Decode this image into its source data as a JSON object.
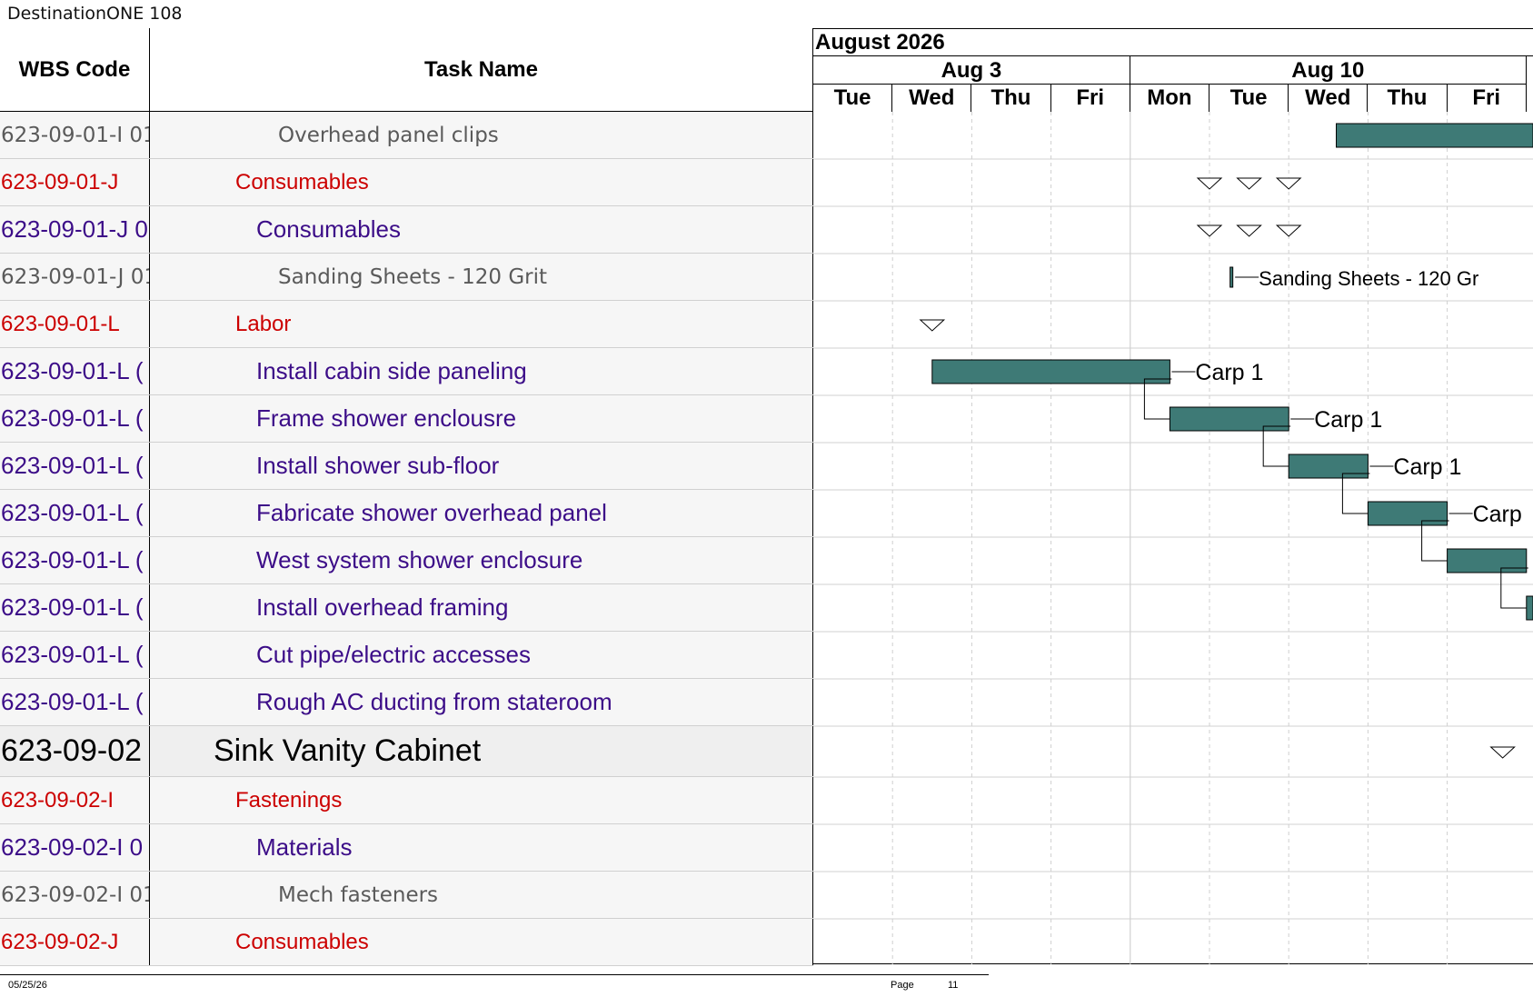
{
  "document": {
    "title": "DestinationONE 108"
  },
  "columns": {
    "wbs": "WBS Code",
    "task": "Task Name"
  },
  "timeline": {
    "month": "August 2026",
    "weeks": [
      {
        "label": "Aug 3"
      },
      {
        "label": "Aug 10"
      }
    ],
    "days": [
      "Tue",
      "Wed",
      "Thu",
      "Fri",
      "Mon",
      "Tue",
      "Wed",
      "Thu",
      "Fri"
    ]
  },
  "rows": [
    {
      "wbs": "623-09-01-I 01",
      "name": "Overhead panel clips",
      "level": "detail"
    },
    {
      "wbs": "623-09-01-J",
      "name": "Consumables",
      "level": "summary"
    },
    {
      "wbs": "623-09-01-J 0",
      "name": "Consumables",
      "level": "sub"
    },
    {
      "wbs": "623-09-01-J 01",
      "name": "Sanding Sheets - 120 Grit",
      "level": "detail"
    },
    {
      "wbs": "623-09-01-L",
      "name": "Labor",
      "level": "summary"
    },
    {
      "wbs": "623-09-01-L (",
      "name": "Install cabin side paneling",
      "level": "sub"
    },
    {
      "wbs": "623-09-01-L (",
      "name": "Frame shower enclousre",
      "level": "sub"
    },
    {
      "wbs": "623-09-01-L (",
      "name": "Install shower sub-floor",
      "level": "sub"
    },
    {
      "wbs": "623-09-01-L (",
      "name": "Fabricate shower overhead panel",
      "level": "sub"
    },
    {
      "wbs": "623-09-01-L (",
      "name": "West system shower enclosure",
      "level": "sub"
    },
    {
      "wbs": "623-09-01-L (",
      "name": "Install overhead framing",
      "level": "sub"
    },
    {
      "wbs": "623-09-01-L (",
      "name": "Cut pipe/electric accesses",
      "level": "sub"
    },
    {
      "wbs": "623-09-01-L (",
      "name": "Rough AC ducting from stateroom",
      "level": "sub"
    },
    {
      "wbs": "623-09-02",
      "name": "Sink Vanity Cabinet",
      "level": "top"
    },
    {
      "wbs": "623-09-02-I",
      "name": "Fastenings",
      "level": "summary"
    },
    {
      "wbs": "623-09-02-I 0",
      "name": "Materials",
      "level": "sub"
    },
    {
      "wbs": "623-09-02-I 01",
      "name": "Mech fasteners",
      "level": "detail"
    },
    {
      "wbs": "623-09-02-J",
      "name": "Consumables",
      "level": "summary"
    }
  ],
  "bars": [
    {
      "row": 0,
      "start": 6.6,
      "end": 9.1,
      "label": ""
    },
    {
      "row": 3,
      "start": 5.26,
      "end": 5.3,
      "label": "Sanding Sheets - 120 Gr",
      "milestone": true
    },
    {
      "row": 5,
      "start": 1.5,
      "end": 4.5,
      "label": "Carp 1"
    },
    {
      "row": 6,
      "start": 4.5,
      "end": 6.0,
      "label": "Carp 1"
    },
    {
      "row": 7,
      "start": 6.0,
      "end": 7.0,
      "label": "Carp 1"
    },
    {
      "row": 8,
      "start": 7.0,
      "end": 8.0,
      "label": "Carp"
    },
    {
      "row": 9,
      "start": 8.0,
      "end": 9.0,
      "label": ""
    },
    {
      "row": 10,
      "start": 9.0,
      "end": 9.2,
      "label": ""
    }
  ],
  "summary_markers": [
    {
      "row": 1,
      "start": 5.0,
      "end": 6.0
    },
    {
      "row": 2,
      "start": 5.0,
      "end": 6.0
    },
    {
      "row": 4,
      "start": 1.5,
      "end": 1.5
    },
    {
      "row": 13,
      "start": 8.7,
      "end": 8.7
    }
  ],
  "footer": {
    "date": "05/25/26",
    "page_label": "Page",
    "page_number": "11"
  },
  "colors": {
    "bar": "#3e7a76",
    "bar_border": "#000000",
    "summary": "#cc0000",
    "subtask": "#3c0d88",
    "detail": "#5a5a5a"
  }
}
